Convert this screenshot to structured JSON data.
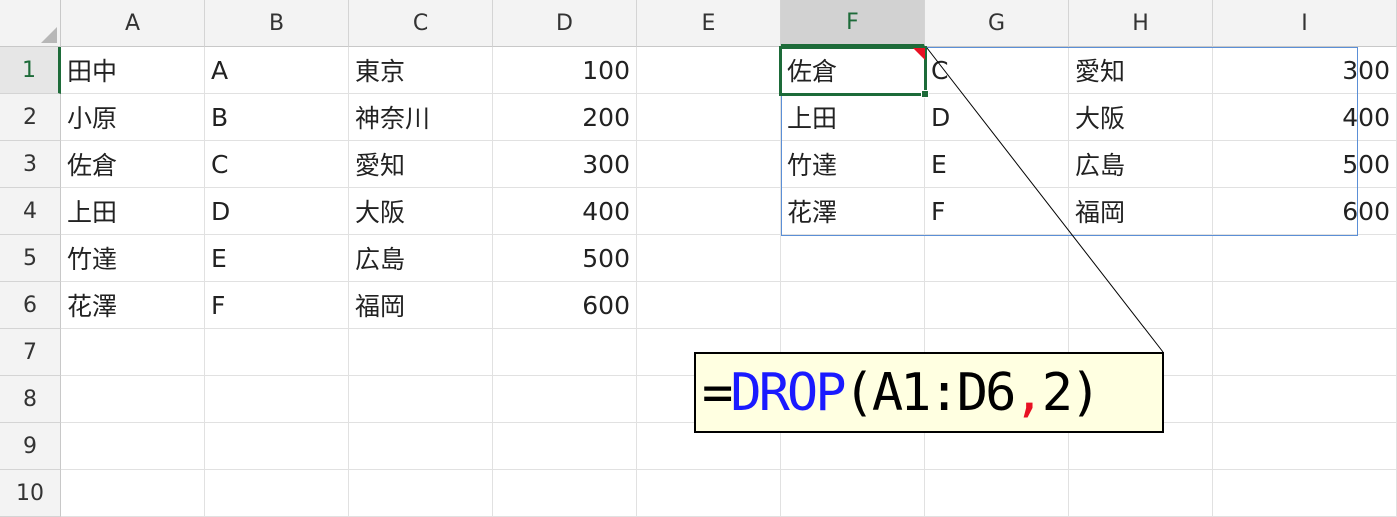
{
  "columns": [
    "A",
    "B",
    "C",
    "D",
    "E",
    "F",
    "G",
    "H",
    "I"
  ],
  "selected_column": "F",
  "rows": [
    "1",
    "2",
    "3",
    "4",
    "5",
    "6",
    "7",
    "8",
    "9",
    "10"
  ],
  "selected_row": "1",
  "cells": [
    {
      "ref": "A1",
      "value": "田中"
    },
    {
      "ref": "B1",
      "value": "A"
    },
    {
      "ref": "C1",
      "value": "東京"
    },
    {
      "ref": "D1",
      "value": "100"
    },
    {
      "ref": "A2",
      "value": "小原"
    },
    {
      "ref": "B2",
      "value": "B"
    },
    {
      "ref": "C2",
      "value": "神奈川"
    },
    {
      "ref": "D2",
      "value": "200"
    },
    {
      "ref": "A3",
      "value": "佐倉"
    },
    {
      "ref": "B3",
      "value": "C"
    },
    {
      "ref": "C3",
      "value": "愛知"
    },
    {
      "ref": "D3",
      "value": "300"
    },
    {
      "ref": "A4",
      "value": "上田"
    },
    {
      "ref": "B4",
      "value": "D"
    },
    {
      "ref": "C4",
      "value": "大阪"
    },
    {
      "ref": "D4",
      "value": "400"
    },
    {
      "ref": "A5",
      "value": "竹達"
    },
    {
      "ref": "B5",
      "value": "E"
    },
    {
      "ref": "C5",
      "value": "広島"
    },
    {
      "ref": "D5",
      "value": "500"
    },
    {
      "ref": "A6",
      "value": "花澤"
    },
    {
      "ref": "B6",
      "value": "F"
    },
    {
      "ref": "C6",
      "value": "福岡"
    },
    {
      "ref": "D6",
      "value": "600"
    },
    {
      "ref": "F1",
      "value": "佐倉"
    },
    {
      "ref": "G1",
      "value": "C"
    },
    {
      "ref": "H1",
      "value": "愛知"
    },
    {
      "ref": "I1",
      "value": "300"
    },
    {
      "ref": "F2",
      "value": "上田"
    },
    {
      "ref": "G2",
      "value": "D"
    },
    {
      "ref": "H2",
      "value": "大阪"
    },
    {
      "ref": "I2",
      "value": "400"
    },
    {
      "ref": "F3",
      "value": "竹達"
    },
    {
      "ref": "G3",
      "value": "E"
    },
    {
      "ref": "H3",
      "value": "広島"
    },
    {
      "ref": "I3",
      "value": "500"
    },
    {
      "ref": "F4",
      "value": "花澤"
    },
    {
      "ref": "G4",
      "value": "F"
    },
    {
      "ref": "H4",
      "value": "福岡"
    },
    {
      "ref": "I4",
      "value": "600"
    }
  ],
  "active_cell": "F1",
  "spill_range": "F1:I4",
  "formula_callout": {
    "equals": "=",
    "function": "DROP",
    "open": "(",
    "range": "A1:D6",
    "comma": ",",
    "arg": "2",
    "close": ")"
  },
  "colors": {
    "selection_green": "#1d6b39",
    "spill_blue": "#5b8fd6",
    "callout_bg": "#ffffe1",
    "function_blue": "#1a1aff",
    "comma_red": "#e81123"
  }
}
